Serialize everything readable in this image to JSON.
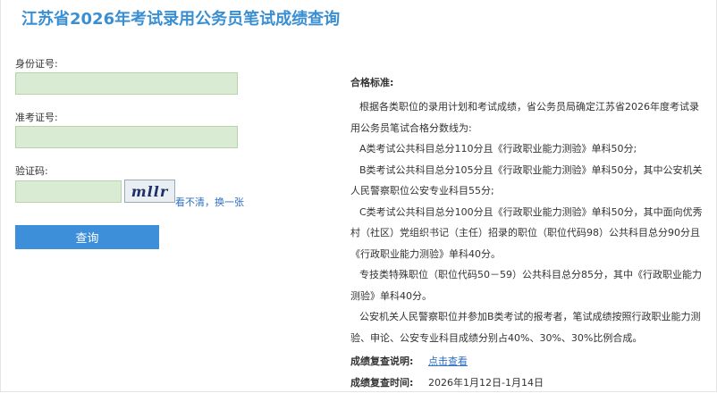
{
  "title": "江苏省2026年考试录用公务员笔试成绩查询",
  "form": {
    "id_label": "身份证号:",
    "id_value": "",
    "exam_label": "准考证号:",
    "exam_value": "",
    "captcha_label": "验证码:",
    "captcha_value": "",
    "captcha_text": "mllr",
    "refresh_text": "看不清，换一张",
    "submit_label": "查询"
  },
  "standard": {
    "heading": "合格标准:",
    "paragraphs": [
      "根据各类职位的录用计划和考试成绩，省公务员局确定江苏省2026年度考试录用公务员笔试合格分数线为:",
      "A类考试公共科目总分110分且《行政职业能力测验》单科50分;",
      "B类考试公共科目总分105分且《行政职业能力测验》单科50分，其中公安机关人民警察职位公安专业科目55分;",
      "C类考试公共科目总分100分且《行政职业能力测验》单科50分，其中面向优秀村（社区）党组织书记（主任）招录的职位（职位代码98）公共科目总分90分且《行政职业能力测验》单科40分。",
      "专技类特殊职位（职位代码50－59）公共科目总分85分，其中《行政职业能力测验》单科40分。",
      "公安机关人民警察职位并参加B类考试的报考者，笔试成绩按照行政职业能力测验、申论、公安专业科目成绩分别占40%、30%、30%比例合成。"
    ]
  },
  "review": {
    "label": "成绩复查说明:",
    "link_text": "点击查看",
    "time_label": "成绩复查时间:",
    "time_value": "2026年1月12日-1月14日"
  },
  "colors": {
    "title": "#3a8fd3",
    "input_bg": "#d9ecd3",
    "button": "#3d8fd9",
    "link": "#2d6fc4"
  }
}
